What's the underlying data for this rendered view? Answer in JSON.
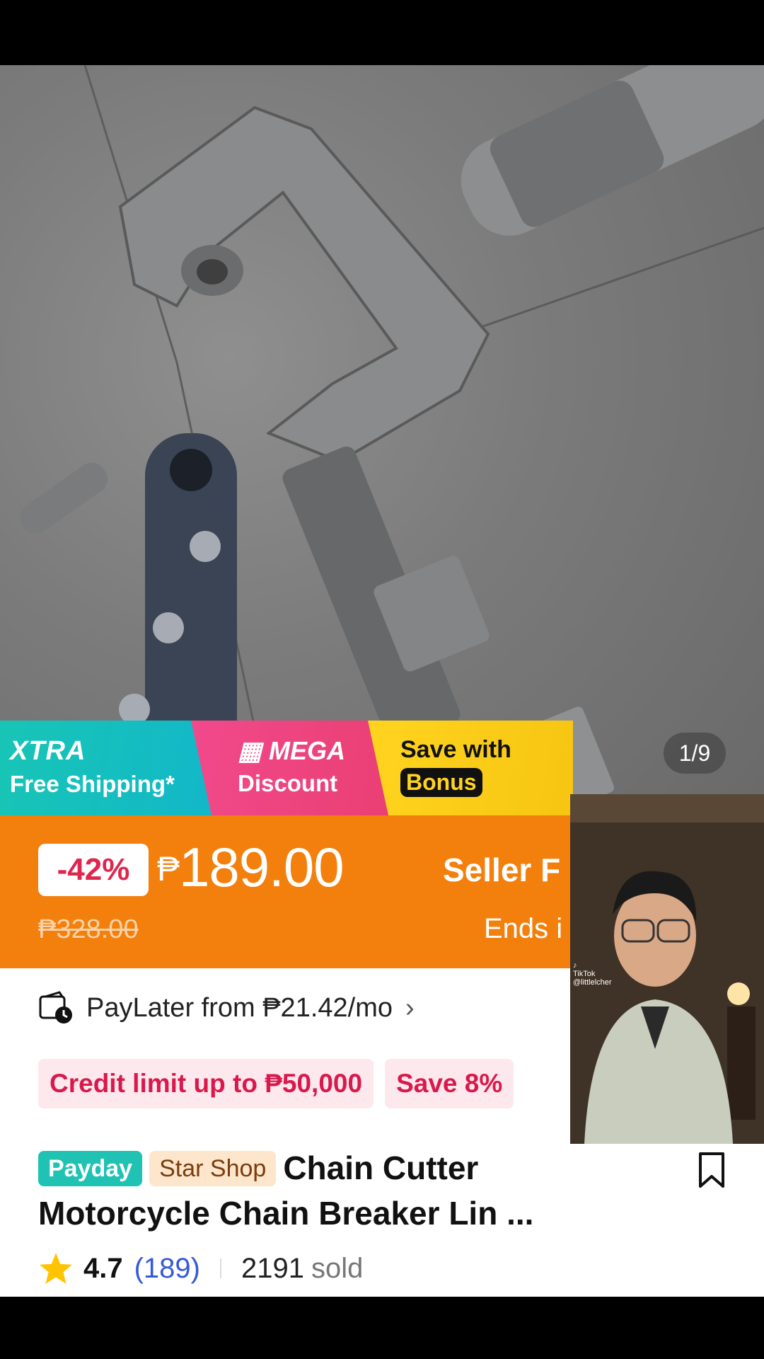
{
  "gallery": {
    "counter": "1/9"
  },
  "promos": {
    "xtra_title": "XTRA",
    "xtra_sub": "Free Shipping*",
    "mega_title": "MEGA",
    "mega_sub": "Discount",
    "bonus_title": "Save with",
    "bonus_tag": "Bonus"
  },
  "price": {
    "discount": "-42%",
    "currency": "₱",
    "amount": "189.00",
    "original": "₱328.00",
    "flash_title": "Seller F",
    "flash_ends": "Ends i"
  },
  "paylater": {
    "text": "PayLater from ₱21.42/mo"
  },
  "credit_tags": [
    "Credit limit up to ₱50,000",
    "Save 8%"
  ],
  "product": {
    "badge_payday": "Payday",
    "badge_star": "Star Shop",
    "title": "Chain Cutter Motorcycle Chain Breaker Lin ..."
  },
  "rating": {
    "value": "4.7",
    "count": "(189)",
    "sold_count": "2191",
    "sold_label": "sold"
  },
  "pip_video": {
    "watermark": "TikTok",
    "handle": "@littlelcher"
  },
  "colors": {
    "orange": "#f37f0c",
    "teal": "#1fc2b3",
    "pink": "#ea3f73",
    "yellow": "#ffd41f",
    "red": "#d9194c",
    "link_blue": "#3559d9"
  }
}
